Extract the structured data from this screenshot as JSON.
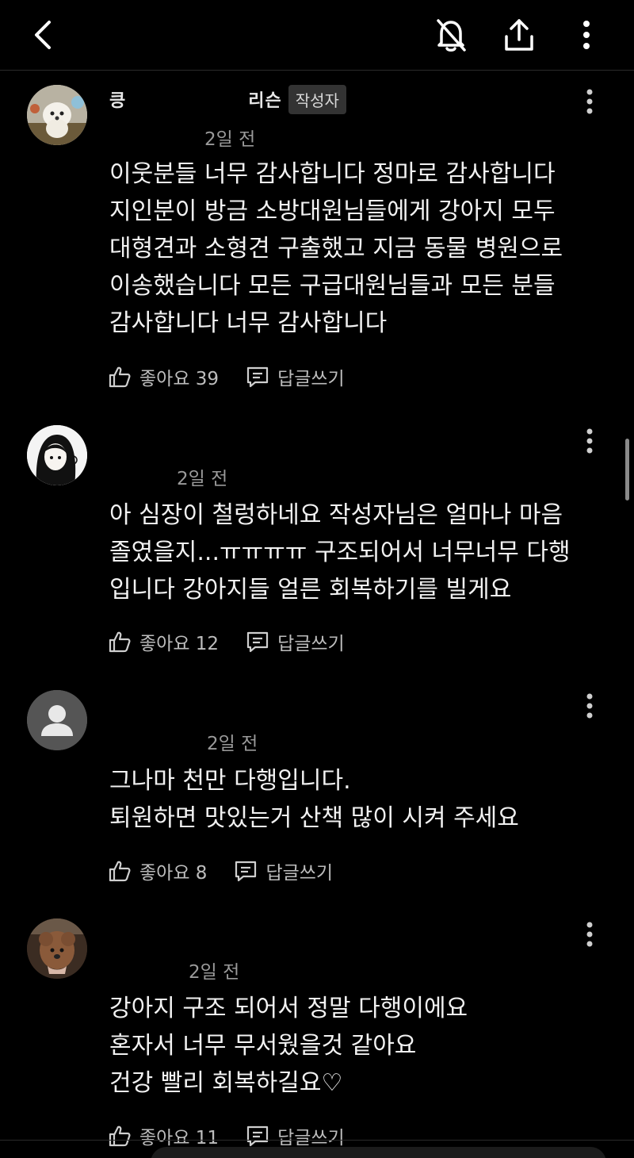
{
  "header": {
    "back_icon": "chevron-left-icon",
    "notify_icon": "bell-off-icon",
    "share_icon": "share-icon",
    "menu_icon": "more-vertical-icon"
  },
  "author_badge": "작성자",
  "comments": [
    {
      "name_visible": "킁",
      "name_tail": "리슨",
      "date": "2일 전",
      "body": "이웃분들 너무 감사합니다 정마로 감사합니다\n지인분이 방금 소방대원님들에게 강아지 모두\n대형견과 소형견 구출했고 지금 동물 병원으로\n이송했습니다 모든 구급대원님들과 모든 분들\n감사합니다 너무 감사합니다",
      "like_label": "좋아요 39",
      "reply_label": "답글쓰기"
    },
    {
      "date": "2일 전",
      "body": "아 심장이 철렁하네요 작성자님은 얼마나 마음\n졸였을지...ㅠㅠㅠㅠ 구조되어서 너무너무 다행\n입니다 강아지들 얼른 회복하기를 빌게요",
      "like_label": "좋아요 12",
      "reply_label": "답글쓰기"
    },
    {
      "date": "2일 전",
      "body": "그나마 천만 다행입니다.\n퇴원하면 맛있는거 산책 많이 시켜 주세요",
      "like_label": "좋아요 8",
      "reply_label": "답글쓰기"
    },
    {
      "date": "2일 전",
      "body": "강아지 구조 되어서 정말 다행이에요\n혼자서 너무 무서웠을것 같아요\n건강 빨리 회복하길요♡",
      "like_label": "좋아요 11",
      "reply_label": "답글쓰기"
    }
  ]
}
